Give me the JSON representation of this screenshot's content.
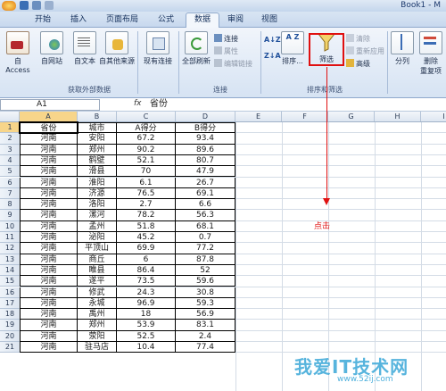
{
  "window": {
    "title": "Book1 - M"
  },
  "tabs": [
    {
      "label": "开始",
      "active": false
    },
    {
      "label": "插入",
      "active": false
    },
    {
      "label": "页面布局",
      "active": false
    },
    {
      "label": "公式",
      "active": false
    },
    {
      "label": "数据",
      "active": true
    },
    {
      "label": "审阅",
      "active": false
    },
    {
      "label": "视图",
      "active": false
    }
  ],
  "ribbon": {
    "get_external": {
      "label": "获取外部数据",
      "buttons": [
        "自 Access",
        "自网站",
        "自文本",
        "自其他来源",
        "现有连接"
      ]
    },
    "connections": {
      "label": "连接",
      "refresh": "全部刷新",
      "small": [
        "连接",
        "属性",
        "编辑链接"
      ]
    },
    "sort_filter": {
      "label": "排序和筛选",
      "sort": "排序...",
      "filter": "筛选",
      "small": [
        "清除",
        "重新应用",
        "高级"
      ]
    },
    "tools": {
      "split": "分列",
      "delete": "删除",
      "dup": "重复项"
    }
  },
  "formula_bar": {
    "name_box": "A1",
    "fx": "fx",
    "value": "省份"
  },
  "columns": [
    "A",
    "B",
    "C",
    "D",
    "E",
    "F",
    "G",
    "H",
    "I"
  ],
  "rows": [
    "1",
    "2",
    "3",
    "4",
    "5",
    "6",
    "7",
    "8",
    "9",
    "10",
    "11",
    "12",
    "13",
    "14",
    "15",
    "16",
    "17",
    "18",
    "19",
    "20",
    "21"
  ],
  "table": [
    [
      "省份",
      "城市",
      "A得分",
      "B得分"
    ],
    [
      "河南",
      "安阳",
      "67.2",
      "93.4"
    ],
    [
      "河南",
      "郑州",
      "90.2",
      "89.6"
    ],
    [
      "河南",
      "鹤壁",
      "52.1",
      "80.7"
    ],
    [
      "河南",
      "滑县",
      "70",
      "47.9"
    ],
    [
      "河南",
      "淮阳",
      "6.1",
      "26.7"
    ],
    [
      "河南",
      "济源",
      "76.5",
      "69.1"
    ],
    [
      "河南",
      "洛阳",
      "2.7",
      "6.6"
    ],
    [
      "河南",
      "漯河",
      "78.2",
      "56.3"
    ],
    [
      "河南",
      "孟州",
      "51.8",
      "68.1"
    ],
    [
      "河南",
      "泌阳",
      "45.2",
      "0.7"
    ],
    [
      "河南",
      "平顶山",
      "69.9",
      "77.2"
    ],
    [
      "河南",
      "商丘",
      "6",
      "87.8"
    ],
    [
      "河南",
      "睢县",
      "86.4",
      "52"
    ],
    [
      "河南",
      "遂平",
      "73.5",
      "59.6"
    ],
    [
      "河南",
      "修武",
      "24.3",
      "30.8"
    ],
    [
      "河南",
      "永城",
      "96.9",
      "59.3"
    ],
    [
      "河南",
      "禹州",
      "18",
      "56.9"
    ],
    [
      "河南",
      "郑州",
      "53.9",
      "83.1"
    ],
    [
      "河南",
      "荥阳",
      "52.5",
      "2.4"
    ],
    [
      "河南",
      "驻马店",
      "10.4",
      "77.4"
    ]
  ],
  "annotation": {
    "click_label": "点击"
  },
  "watermark": {
    "text": "我爱IT技术网",
    "url": "www.52ij.com"
  },
  "colors": {
    "accent_red": "#e01010",
    "ribbon_blue": "#d6e3f3",
    "selected_header": "#f7d58a"
  }
}
